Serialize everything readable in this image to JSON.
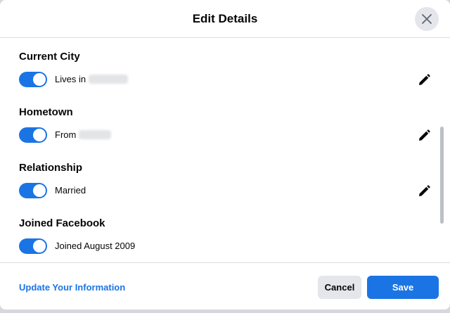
{
  "dialog": {
    "title": "Edit Details",
    "close_icon": "close-icon"
  },
  "sections": [
    {
      "title": "Current City",
      "text": "Lives in",
      "redacted": true,
      "toggle_on": true,
      "editable": true
    },
    {
      "title": "Hometown",
      "text": "From",
      "redacted": true,
      "toggle_on": true,
      "editable": true
    },
    {
      "title": "Relationship",
      "text": "Married",
      "redacted": false,
      "toggle_on": true,
      "editable": true
    },
    {
      "title": "Joined Facebook",
      "text": "Joined August 2009",
      "redacted": false,
      "toggle_on": true,
      "editable": false
    }
  ],
  "footer": {
    "update_link": "Update Your Information",
    "cancel_label": "Cancel",
    "save_label": "Save"
  },
  "colors": {
    "accent": "#1b74e4",
    "secondary_button": "#e4e6eb",
    "text": "#050505"
  }
}
